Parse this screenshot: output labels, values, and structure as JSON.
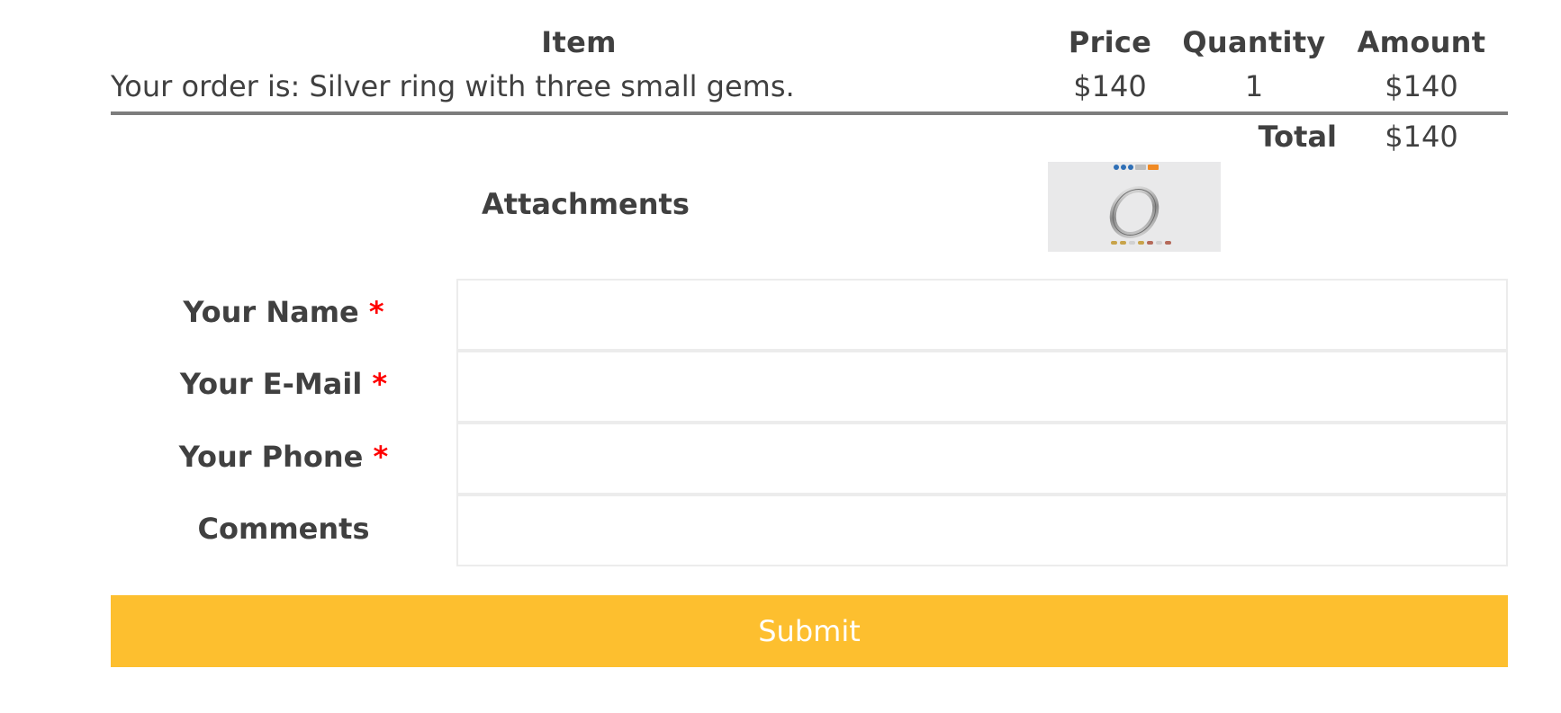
{
  "table": {
    "headers": {
      "item": "Item",
      "price": "Price",
      "quantity": "Quantity",
      "amount": "Amount"
    },
    "row": {
      "item": "Your order is: Silver ring with three small gems.",
      "price": "$140",
      "quantity": "1",
      "amount": "$140"
    },
    "total_label": "Total",
    "total_value": "$140"
  },
  "attachments": {
    "label": "Attachments",
    "thumbnail_icon": "ring-thumbnail"
  },
  "form": {
    "name_label": "Your Name",
    "email_label": "Your E-Mail",
    "phone_label": "Your Phone",
    "comments_label": "Comments",
    "required_mark": "*",
    "name_value": "",
    "email_value": "",
    "phone_value": "",
    "comments_value": "",
    "submit_label": "Submit"
  },
  "colors": {
    "accent": "#fdbf2f",
    "required": "#ff0000",
    "text": "#404040"
  }
}
